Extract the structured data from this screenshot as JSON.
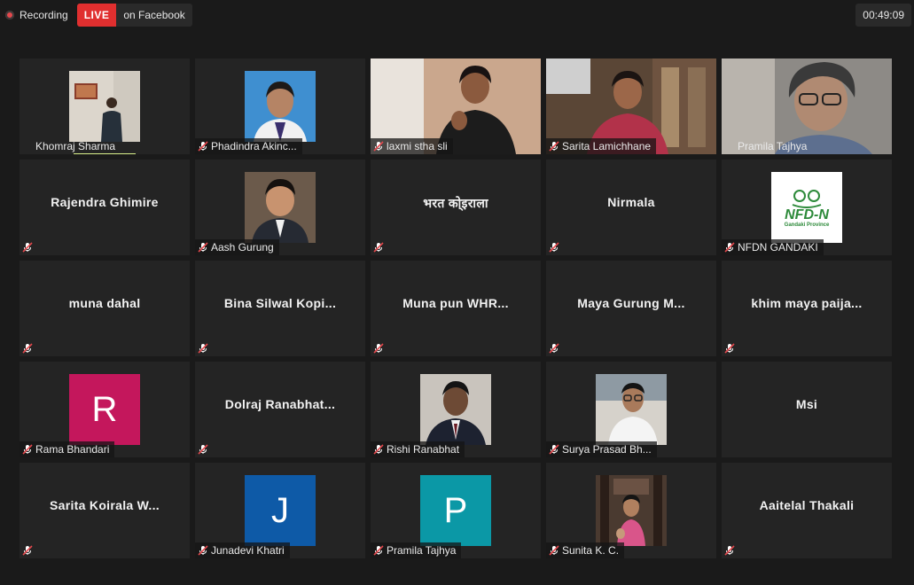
{
  "recording": {
    "label": "Recording"
  },
  "live": {
    "badge": "LIVE",
    "platform": "on Facebook"
  },
  "timer": "00:49:09",
  "colors": {
    "live_red": "#e02f2f",
    "active_border": "#d9f08a",
    "muted_icon": "#e5484d"
  },
  "participants": [
    {
      "name": "Khomraj Sharma"
    },
    {
      "name": "Phadindra Akinc..."
    },
    {
      "name": "laxmi stha sli"
    },
    {
      "name": "Sarita Lamichhane"
    },
    {
      "name": "Pramila Tajhya"
    },
    {
      "name": "Rajendra Ghimire"
    },
    {
      "name": "Aash Gurung"
    },
    {
      "name": "भरत को्इराला"
    },
    {
      "name": "Nirmala"
    },
    {
      "name": "NFDN GANDAKI",
      "logo_text": "NFD-N",
      "logo_sub": "Gandaki Province"
    },
    {
      "name": "muna dahal"
    },
    {
      "name": "Bina  Silwal  Kopi..."
    },
    {
      "name": "Muna  pun  WHR..."
    },
    {
      "name": "Maya  Gurung  M..."
    },
    {
      "name": "khim  maya  paija..."
    },
    {
      "name": "Rama Bhandari",
      "initial": "R"
    },
    {
      "name": "Dolraj  Ranabhat..."
    },
    {
      "name": "Rishi Ranabhat"
    },
    {
      "name": "Surya Prasad Bh..."
    },
    {
      "name": "Msi"
    },
    {
      "name": "Sarita  Koirala  W..."
    },
    {
      "name": "Junadevi Khatri",
      "initial": "J"
    },
    {
      "name": "Pramila Tajhya",
      "initial": "P"
    },
    {
      "name": "Sunita K. C."
    },
    {
      "name": "Aaitelal Thakali"
    }
  ]
}
